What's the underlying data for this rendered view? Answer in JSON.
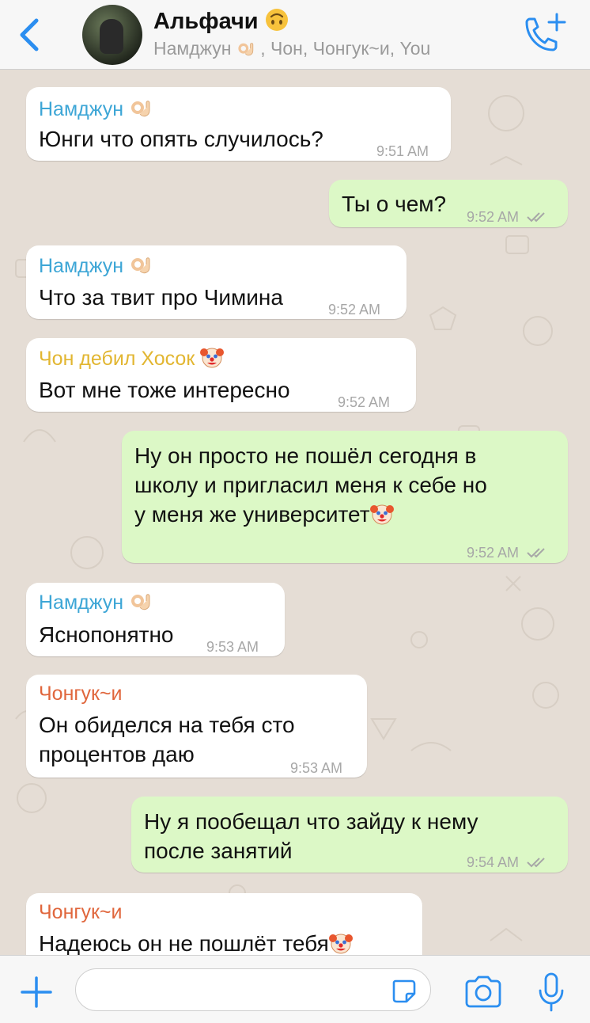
{
  "header": {
    "title": "Альфачи",
    "title_emoji": "upside-down-face-emoji",
    "subtitle_first": "Намджун",
    "subtitle_rest": ", Чон, Чонгук~и, You"
  },
  "messages": [
    {
      "sender": "Намджун",
      "text": "Юнги что опять случилось?",
      "time": "9:51 AM"
    },
    {
      "text": "Ты о чем?",
      "time": "9:52 AM"
    },
    {
      "sender": "Намджун",
      "text": "Что за твит про Чимина",
      "time": "9:52 AM"
    },
    {
      "sender": "Чон дебил Хосок",
      "text": "Вот мне тоже интересно",
      "time": "9:52 AM"
    },
    {
      "lines": [
        "Ну он просто не пошёл сегодня в",
        "школу и пригласил меня к себе но",
        "у меня же университет"
      ],
      "time": "9:52 AM"
    },
    {
      "sender": "Намджун",
      "text": "Яснопонятно",
      "time": "9:53 AM"
    },
    {
      "sender": "Чонгук~и",
      "lines": [
        "Он обиделся на тебя сто",
        "процентов даю"
      ],
      "time": "9:53 AM"
    },
    {
      "lines": [
        "Ну я пообещал что зайду к нему",
        "после занятий"
      ],
      "time": "9:54 AM"
    },
    {
      "sender": "Чонгук~и",
      "text": "Надеюсь он не пошлёт тебя"
    }
  ],
  "input": {
    "placeholder": "",
    "value": ""
  },
  "colors": {
    "accent": "#2b8ef0",
    "sender_namjoon": "#3da6d6",
    "sender_hosok": "#e2b631",
    "sender_jungkook": "#e0663c",
    "outgoing_bubble": "#dcf8c6",
    "chat_background": "#e5ddd5"
  }
}
